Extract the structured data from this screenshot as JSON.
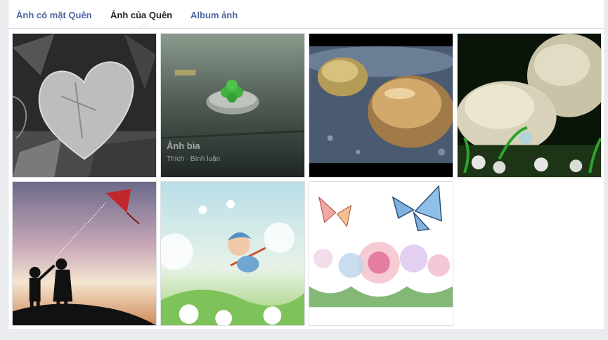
{
  "tabs": [
    {
      "label": "Ảnh có mặt Quên",
      "active": false
    },
    {
      "label": "Ảnh của Quên",
      "active": true
    },
    {
      "label": "Album ảnh",
      "active": false
    }
  ],
  "photos": [
    {
      "subject": "stone-heart"
    },
    {
      "subject": "clover-on-stone",
      "overlay_title": "Ảnh bìa",
      "overlay_actions": "Thích · Bình luận"
    },
    {
      "subject": "wet-pebbles"
    },
    {
      "subject": "water-drop-stones"
    },
    {
      "subject": "kids-with-kite"
    },
    {
      "subject": "dandelion-fairy"
    },
    {
      "subject": "butterflies-flowers"
    }
  ],
  "colors": {
    "link": "#4b67a1",
    "active_tab": "#1d2129",
    "border": "#dddfe2",
    "page_bg": "#e9ebee"
  }
}
